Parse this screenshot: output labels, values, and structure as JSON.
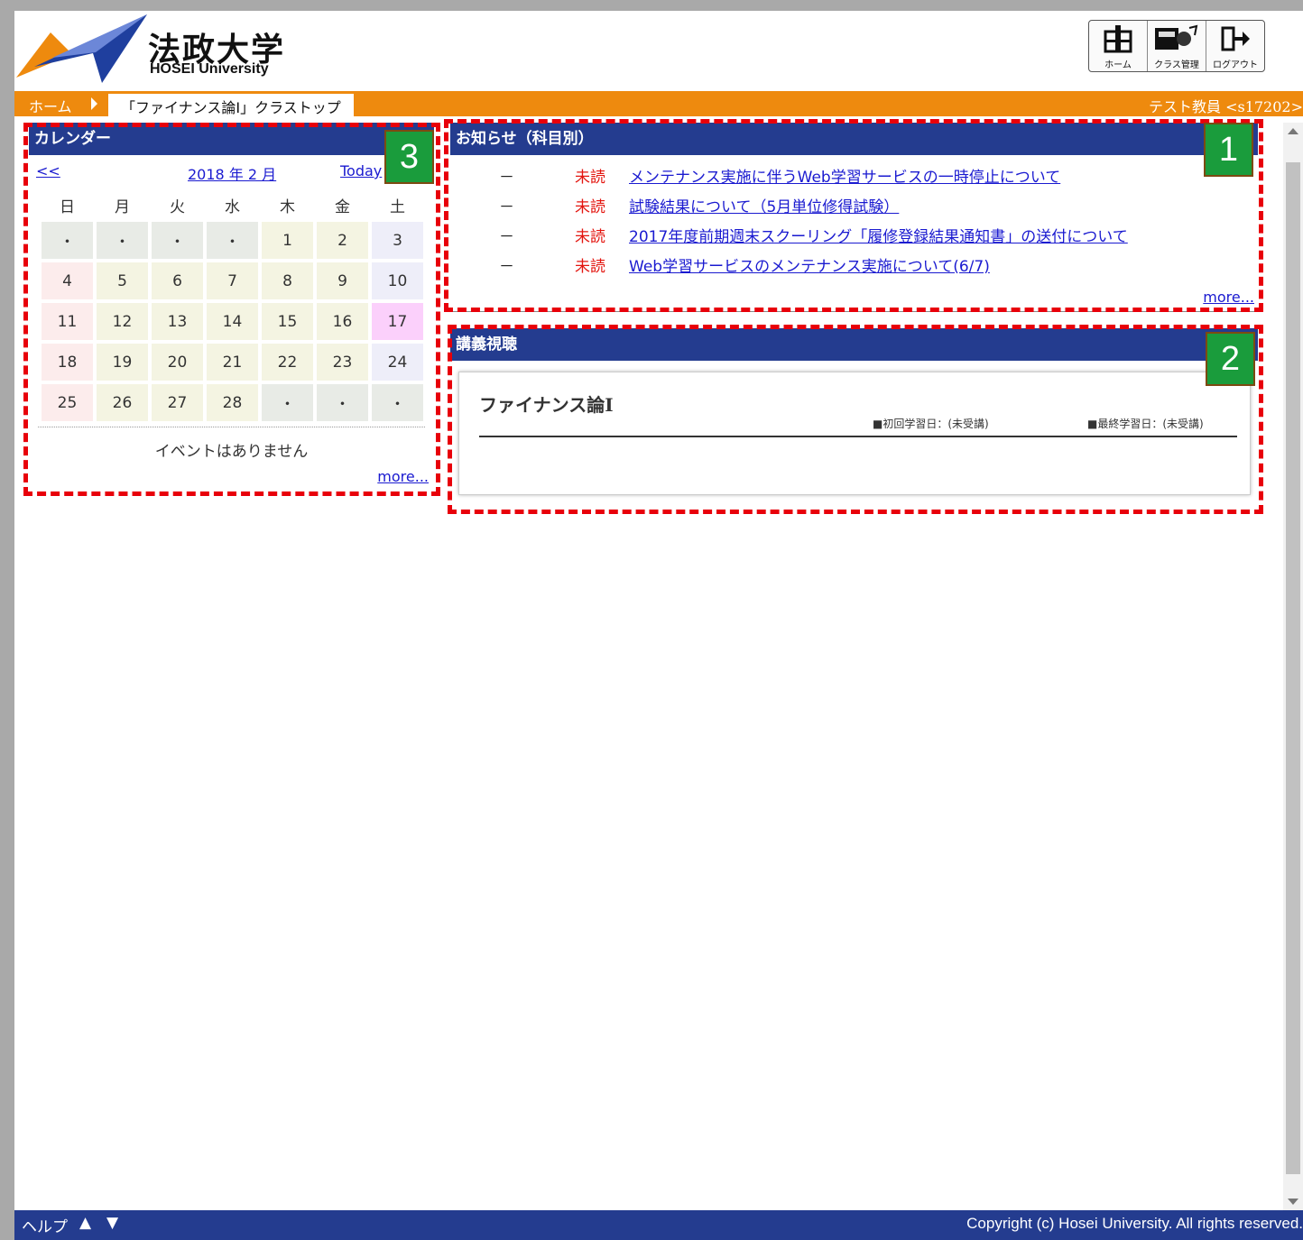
{
  "header": {
    "logo_jp": "法政大学",
    "logo_en": "HOSEI University",
    "toolbar": [
      {
        "label": "ホーム",
        "icon": "home-icon"
      },
      {
        "label": "クラス管理",
        "icon": "class-management-icon"
      },
      {
        "label": "ログアウト",
        "icon": "logout-icon"
      }
    ]
  },
  "breadcrumb": {
    "home": "ホーム",
    "current": "「ファイナンス論Ⅰ」クラストップ"
  },
  "user": "テスト教員 <s17202>",
  "calendar": {
    "title": "カレンダー",
    "prev": "<<",
    "month": "2018 年 2 月",
    "today": "Today",
    "weekdays": [
      "日",
      "月",
      "火",
      "水",
      "木",
      "金",
      "土"
    ],
    "weeks": [
      [
        "・",
        "・",
        "・",
        "・",
        "1",
        "2",
        "3"
      ],
      [
        "4",
        "5",
        "6",
        "7",
        "8",
        "9",
        "10"
      ],
      [
        "11",
        "12",
        "13",
        "14",
        "15",
        "16",
        "17"
      ],
      [
        "18",
        "19",
        "20",
        "21",
        "22",
        "23",
        "24"
      ],
      [
        "25",
        "26",
        "27",
        "28",
        "・",
        "・",
        "・"
      ]
    ],
    "today_date": "17",
    "no_events": "イベントはありません",
    "more": "more..."
  },
  "notices": {
    "title": "お知らせ（科目別）",
    "items": [
      {
        "dash": "－",
        "status": "未読",
        "title": "メンテナンス実施に伴うWeb学習サービスの一時停止について"
      },
      {
        "dash": "－",
        "status": "未読",
        "title": "試験結果について（5月単位修得試験）"
      },
      {
        "dash": "－",
        "status": "未読",
        "title": "2017年度前期週末スクーリング「履修登録結果通知書」の送付について"
      },
      {
        "dash": "－",
        "status": "未読",
        "title": "Web学習サービスのメンテナンス実施について(6/7)"
      }
    ],
    "more": "more..."
  },
  "lecture": {
    "title": "講義視聴",
    "course": "ファイナンス論Ⅰ",
    "first_date": "■初回学習日：(未受講)",
    "last_date": "■最終学習日：(未受講)"
  },
  "annotations": [
    "1",
    "2",
    "3"
  ],
  "footer": {
    "help": "ヘルプ",
    "up": "▲",
    "down": "▼",
    "copyright": "Copyright (c) Hosei University. All rights reserved."
  },
  "colors": {
    "header_bar": "#ee8a0e",
    "panel_head": "#243c8f",
    "highlight": "#e8000a",
    "badge": "#1a9c3c",
    "unread": "#e3150f"
  }
}
